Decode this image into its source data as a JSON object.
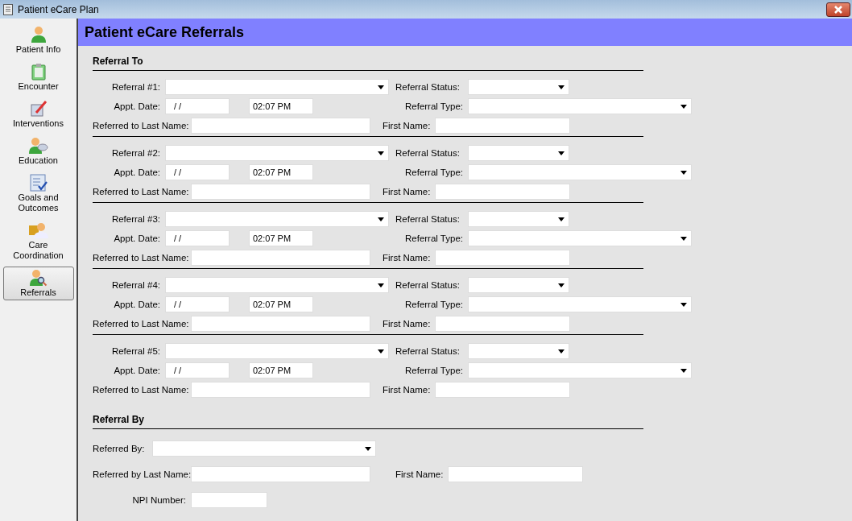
{
  "window": {
    "title": "Patient eCare Plan"
  },
  "sidebar": {
    "items": [
      {
        "label": "Patient Info",
        "selected": false
      },
      {
        "label": "Encounter",
        "selected": false
      },
      {
        "label": "Interventions",
        "selected": false
      },
      {
        "label": "Education",
        "selected": false
      },
      {
        "label": "Goals and Outcomes",
        "selected": false
      },
      {
        "label": "Care Coordination",
        "selected": false
      },
      {
        "label": "Referrals",
        "selected": true
      }
    ]
  },
  "header": {
    "title": "Patient eCare Referrals"
  },
  "referral_to": {
    "title": "Referral To",
    "referrals": [
      {
        "referral_label": "Referral #1:",
        "status_label": "Referral Status:",
        "date_label": "Appt. Date:",
        "date_value": "/ /",
        "time_value": "02:07 PM",
        "type_label": "Referral Type:",
        "last_name_label": "Referred to Last Name:",
        "first_name_label": "First Name:"
      },
      {
        "referral_label": "Referral #2:",
        "status_label": "Referral Status:",
        "date_label": "Appt. Date:",
        "date_value": "/ /",
        "time_value": "02:07 PM",
        "type_label": "Referral Type:",
        "last_name_label": "Referred to Last Name:",
        "first_name_label": "First Name:"
      },
      {
        "referral_label": "Referral #3:",
        "status_label": "Referral Status:",
        "date_label": "Appt. Date:",
        "date_value": "/ /",
        "time_value": "02:07 PM",
        "type_label": "Referral Type:",
        "last_name_label": "Referred to Last Name:",
        "first_name_label": "First Name:"
      },
      {
        "referral_label": "Referral #4:",
        "status_label": "Referral Status:",
        "date_label": "Appt. Date:",
        "date_value": "/ /",
        "time_value": "02:07 PM",
        "type_label": "Referral Type:",
        "last_name_label": "Referred to Last Name:",
        "first_name_label": "First Name:"
      },
      {
        "referral_label": "Referral #5:",
        "status_label": "Referral Status:",
        "date_label": "Appt. Date:",
        "date_value": "/ /",
        "time_value": "02:07 PM",
        "type_label": "Referral Type:",
        "last_name_label": "Referred to Last Name:",
        "first_name_label": "First Name:"
      }
    ]
  },
  "referral_by": {
    "title": "Referral By",
    "referred_by_label": "Referred By:",
    "last_name_label": "Referred by Last Name:",
    "first_name_label": "First Name:",
    "npi_label": "NPI Number:"
  }
}
